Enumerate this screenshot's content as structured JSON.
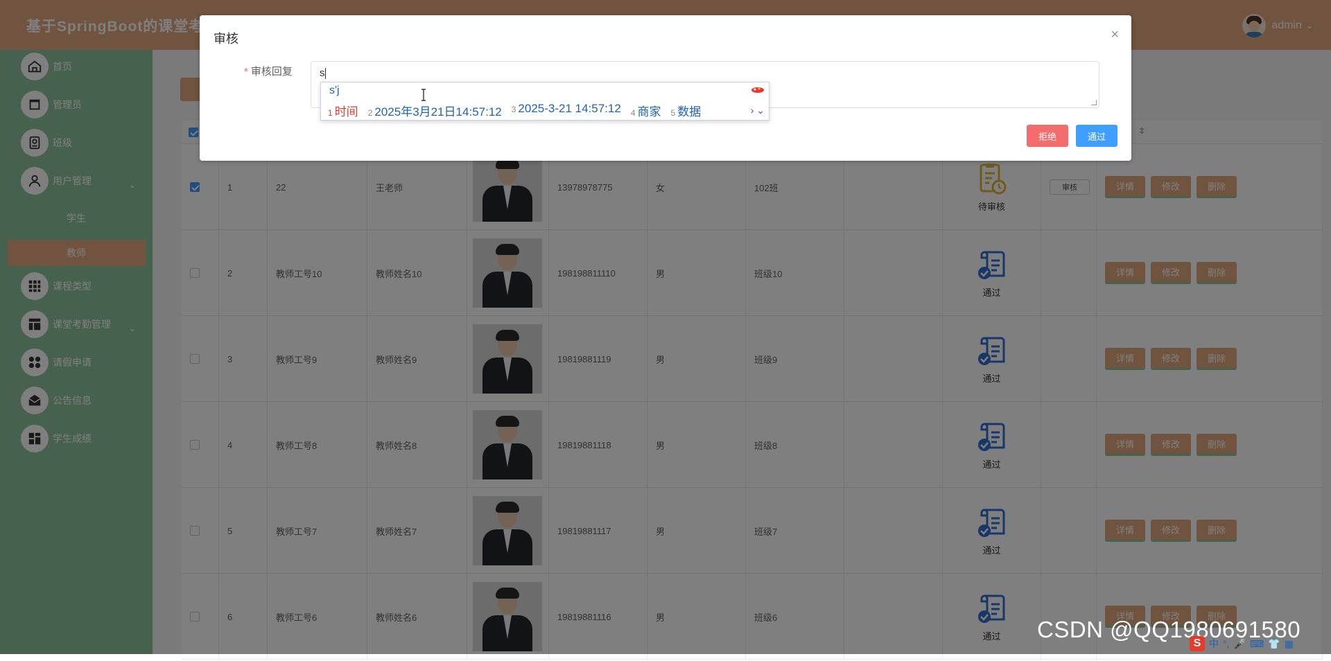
{
  "header": {
    "title": "基于SpringBoot的课堂考",
    "username": "admin"
  },
  "sidebar": {
    "items": [
      {
        "label": "首页",
        "icon": "home-icon"
      },
      {
        "label": "管理员",
        "icon": "admin-icon"
      },
      {
        "label": "班级",
        "icon": "class-icon"
      },
      {
        "label": "用户管理",
        "icon": "user-icon"
      },
      {
        "label": "课程类型",
        "icon": "grid-icon"
      },
      {
        "label": "课堂考勤管理",
        "icon": "layout-icon"
      },
      {
        "label": "请假申请",
        "icon": "leave-icon"
      },
      {
        "label": "公告信息",
        "icon": "mail-icon"
      },
      {
        "label": "学生成绩",
        "icon": "score-icon"
      }
    ],
    "sub_items": [
      {
        "label": "学生"
      },
      {
        "label": "教师"
      }
    ]
  },
  "table": {
    "rows": [
      {
        "index": "1",
        "teacher_no": "22",
        "name": "王老师",
        "phone": "13978978775",
        "gender": "女",
        "class": "102班",
        "status": "待审核",
        "checked": true
      },
      {
        "index": "2",
        "teacher_no": "教师工号10",
        "name": "教师姓名10",
        "phone": "198198811110",
        "gender": "男",
        "class": "班级10",
        "status": "通过",
        "checked": false
      },
      {
        "index": "3",
        "teacher_no": "教师工号9",
        "name": "教师姓名9",
        "phone": "19819881119",
        "gender": "男",
        "class": "班级9",
        "status": "通过",
        "checked": false
      },
      {
        "index": "4",
        "teacher_no": "教师工号8",
        "name": "教师姓名8",
        "phone": "19819881118",
        "gender": "男",
        "class": "班级8",
        "status": "通过",
        "checked": false
      },
      {
        "index": "5",
        "teacher_no": "教师工号7",
        "name": "教师姓名7",
        "phone": "19819881117",
        "gender": "男",
        "class": "班级7",
        "status": "通过",
        "checked": false
      },
      {
        "index": "6",
        "teacher_no": "教师工号6",
        "name": "教师姓名6",
        "phone": "19819881116",
        "gender": "男",
        "class": "班级6",
        "status": "通过",
        "checked": false
      }
    ],
    "audit_label": "审核",
    "ops": {
      "detail": "详情",
      "edit": "修改",
      "delete": "删除"
    }
  },
  "dialog": {
    "title": "审核",
    "close": "×",
    "label": "审核回复",
    "value": "s",
    "reject": "拒绝",
    "pass": "通过"
  },
  "ime": {
    "composition": "s'j",
    "candidates": [
      {
        "num": "1",
        "text": "时间"
      },
      {
        "num": "2",
        "text": "2025年3月21日14:57:12"
      },
      {
        "num": "3",
        "text": "2025-3-21 14:57:12"
      },
      {
        "num": "4",
        "text": "商家"
      },
      {
        "num": "5",
        "text": "数据"
      }
    ],
    "arrows": "› ⌄"
  },
  "watermark": "CSDN @QQ1980691580",
  "tray": {
    "items": [
      "中",
      "°,",
      "🎤",
      "⌨",
      "👕",
      "▦"
    ]
  },
  "colors": {
    "header": "#e2a87e",
    "sidebar": "#8fc29e",
    "primary": "#409eff",
    "danger": "#f56c6c"
  }
}
